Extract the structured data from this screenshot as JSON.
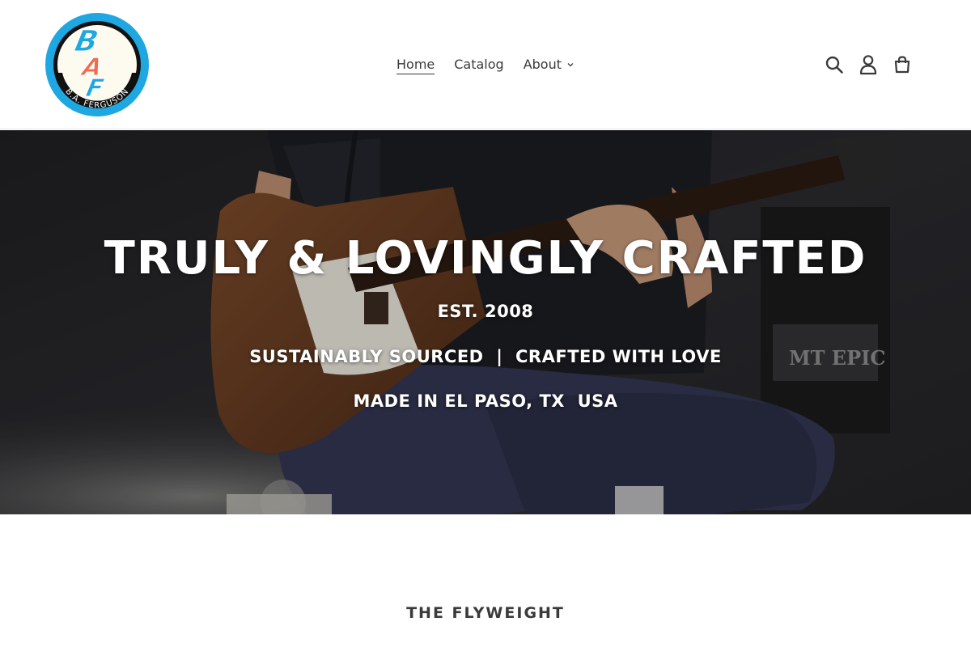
{
  "brand": {
    "logo_text_top": "BAF",
    "logo_ring_text": "B.A. FERGUSON",
    "logo_colors": {
      "ring": "#1ea7e1",
      "accent": "#f26b4f",
      "inner": "#fdfaf0",
      "dark": "#111111"
    }
  },
  "nav": {
    "items": [
      {
        "label": "Home",
        "active": true
      },
      {
        "label": "Catalog",
        "active": false
      },
      {
        "label": "About",
        "has_dropdown": true
      }
    ]
  },
  "header_icons": [
    "search-icon",
    "account-icon",
    "cart-icon"
  ],
  "hero": {
    "title": "TRULY & LOVINGLY CRAFTED",
    "line1": "EST. 2008",
    "line2": "SUSTAINABLY SOURCED  |  CRAFTED WITH LOVE",
    "line3": "MADE IN EL PASO, TX  USA",
    "amp_text": "MT EPIC"
  },
  "section": {
    "heading": "THE FLYWEIGHT"
  }
}
